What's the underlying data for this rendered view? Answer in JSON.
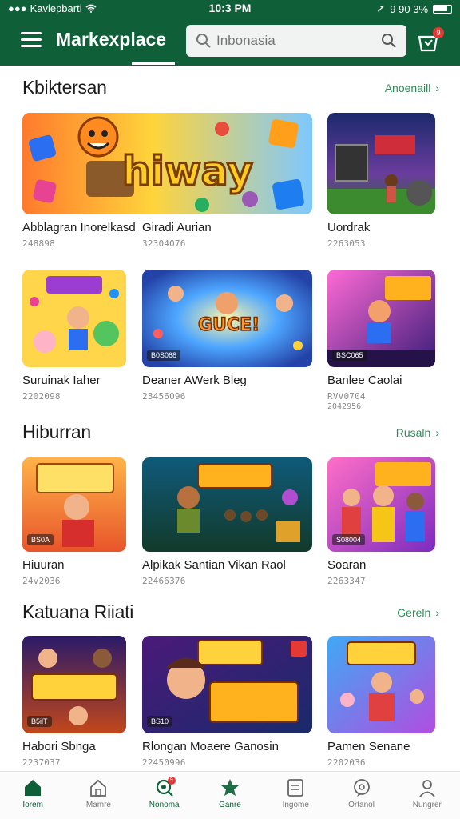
{
  "status_bar": {
    "carrier": "Kavlepbarti",
    "time": "10:3 PM",
    "right": "9 90 3%"
  },
  "header": {
    "title": "Markexplace",
    "search_placeholder": "Inbonasia",
    "cart_badge": "9"
  },
  "colors": {
    "brand": "#0f5f38",
    "accent": "#2e8b57",
    "badge": "#e53935"
  },
  "sections": [
    {
      "title": "Kbiktersan",
      "more": "Anoenaill",
      "items": [
        {
          "name": "Abblagran Inorelkasd",
          "meta": "248898"
        },
        {
          "name": "Giradi Aurian",
          "meta": "32304076"
        },
        {
          "name": "Uordrak",
          "meta": "2263053"
        },
        {
          "name": "Suruinak Iaher",
          "meta": "2202098",
          "tag": ""
        },
        {
          "name": "Deaner AWerk Bleg",
          "meta": "23456096",
          "tag": "B0S068"
        },
        {
          "name": "Banlee Caolai",
          "meta": "RVV0704",
          "meta2": "2042956",
          "tag": "BSC065"
        }
      ]
    },
    {
      "title": "Hiburran",
      "more": "Rusaln",
      "items": [
        {
          "name": "Hiuuran",
          "meta": "24v2036",
          "tag": "BS0A"
        },
        {
          "name": "Alpikak Santian Vikan Raol",
          "meta": "22466376"
        },
        {
          "name": "Soaran",
          "meta": "2263347",
          "tag": "S08004"
        }
      ]
    },
    {
      "title": "Katuana Riiati",
      "more": "Gereln",
      "items": [
        {
          "name": "Habori Sbnga",
          "meta": "2237037",
          "tag": "B5ilT"
        },
        {
          "name": "Rlongan Moaere Ganosin",
          "meta": "22450996",
          "tag": "BS10"
        },
        {
          "name": "Pamen Senane",
          "meta": "2202036"
        }
      ]
    }
  ],
  "bottom_nav": [
    {
      "label": "Iorem",
      "icon": "home-icon",
      "active": true
    },
    {
      "label": "Mamre",
      "icon": "store-icon",
      "active": false
    },
    {
      "label": "Nonoma",
      "icon": "search-badge-icon",
      "active": false,
      "badge": "9"
    },
    {
      "label": "Ganre",
      "icon": "star-bag-icon",
      "active": false
    },
    {
      "label": "Ingome",
      "icon": "list-icon",
      "active": false
    },
    {
      "label": "Ortanol",
      "icon": "chat-icon",
      "active": false
    },
    {
      "label": "Nungrer",
      "icon": "user-icon",
      "active": false
    }
  ]
}
